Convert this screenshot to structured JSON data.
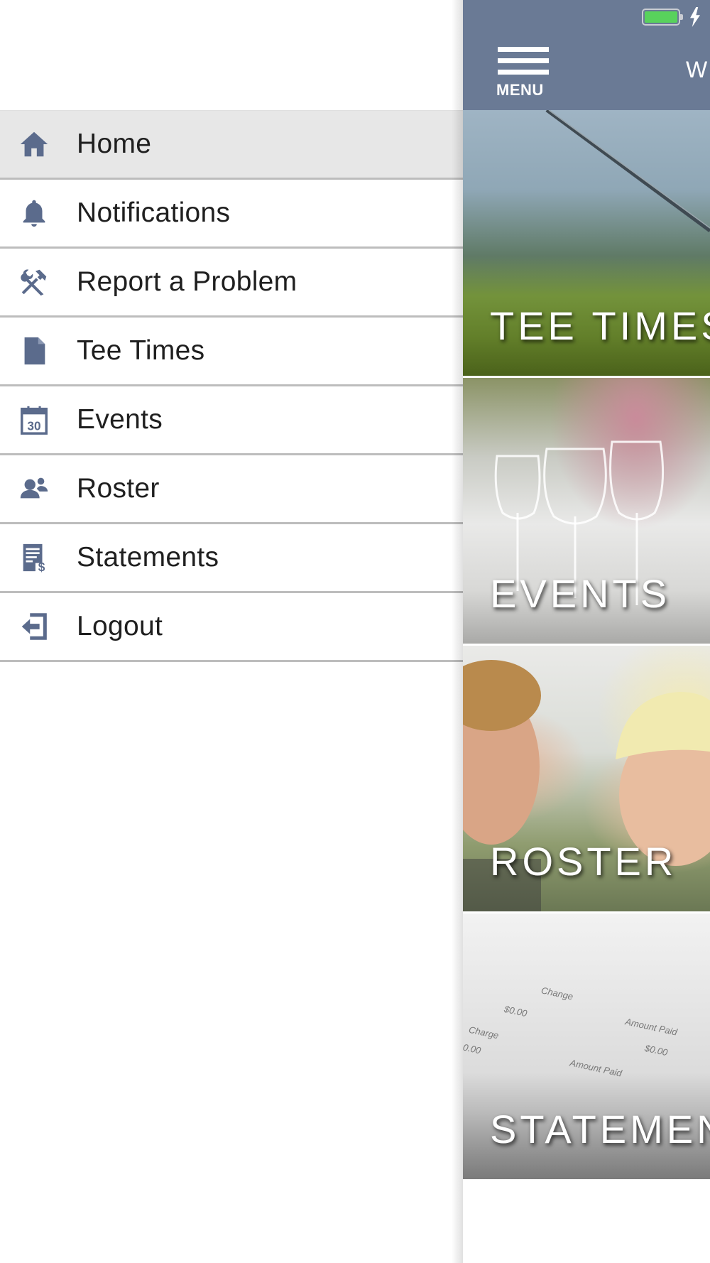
{
  "drawer": {
    "items": [
      {
        "label": "Home",
        "icon": "home-icon",
        "active": true
      },
      {
        "label": "Notifications",
        "icon": "bell-icon",
        "active": false
      },
      {
        "label": "Report a Problem",
        "icon": "tools-icon",
        "active": false
      },
      {
        "label": "Tee Times",
        "icon": "document-icon",
        "active": false
      },
      {
        "label": "Events",
        "icon": "calendar-icon",
        "active": false
      },
      {
        "label": "Roster",
        "icon": "people-icon",
        "active": false
      },
      {
        "label": "Statements",
        "icon": "statement-icon",
        "active": false
      },
      {
        "label": "Logout",
        "icon": "logout-icon",
        "active": false
      }
    ],
    "calendar_day": "30"
  },
  "topbar": {
    "menu_label": "MENU",
    "welcome_text": "W"
  },
  "tiles": [
    {
      "title": "TEE TIMES"
    },
    {
      "title": "EVENTS"
    },
    {
      "title": "ROSTER"
    },
    {
      "title": "STATEMEN"
    }
  ],
  "statement_image_text": {
    "change_1": "Change",
    "value_1": "$0.00",
    "amount_paid_1": "Amount Paid",
    "value_2": "$0.00",
    "change_2": "Charge",
    "value_3": "0.00",
    "amount_paid_2": "Amount Paid"
  },
  "colors": {
    "icon": "#5b6b8c",
    "topbar": "#6a7a95",
    "active_item_bg": "#e7e7e7",
    "battery": "#58d25c"
  }
}
